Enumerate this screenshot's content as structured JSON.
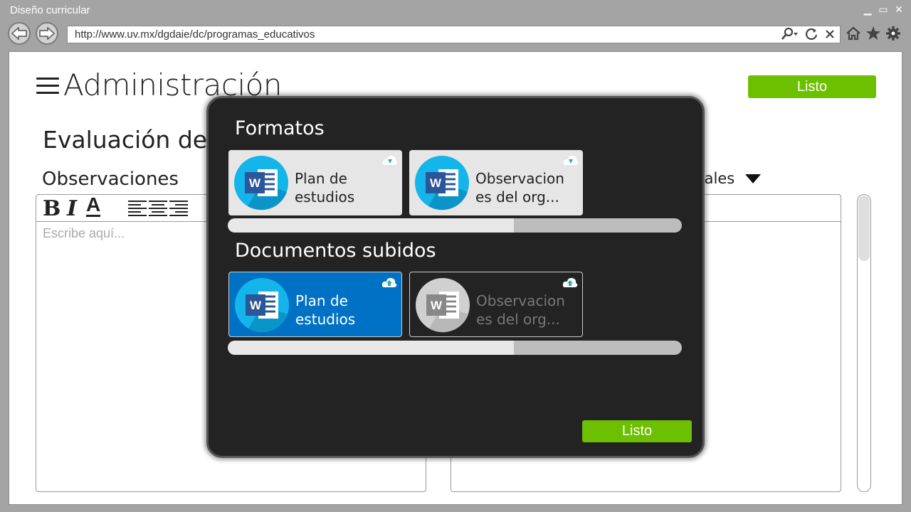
{
  "window": {
    "title": "Diseño curricular",
    "minimize_icon": "minimize-icon",
    "maximize_icon": "maximize-icon",
    "close_icon": "close-icon"
  },
  "toolbar": {
    "back_icon": "back-arrow-icon",
    "forward_icon": "forward-arrow-icon",
    "url": "http://www.uv.mx/dgdaie/dc/programas_educativos",
    "search_icon": "search-icon",
    "refresh_icon": "refresh-icon",
    "stop_icon": "stop-icon",
    "home_icon": "home-icon",
    "favorites_icon": "star-icon",
    "settings_icon": "gear-icon"
  },
  "page": {
    "title": "Administración",
    "done_button": "Listo",
    "section_title": "Evaluación del",
    "observations_title": "Observaciones",
    "editor_placeholder": "Escribe aquí...",
    "editor_tools": {
      "bold": "B",
      "italic": "I",
      "font_color": "A"
    },
    "dropdown_partial_label": "rales"
  },
  "modal": {
    "formats_title": "Formatos",
    "formats": [
      {
        "label_line1": "Plan de",
        "label_line2": "estudios",
        "icon": "word-icon",
        "badge": "download-icon"
      },
      {
        "label_line1": "Observacion",
        "label_line2": "es del org...",
        "icon": "word-icon",
        "badge": "download-icon"
      }
    ],
    "formats_progress": 0.63,
    "uploaded_title": "Documentos subidos",
    "uploaded": [
      {
        "label_line1": "Plan de",
        "label_line2": "estudios",
        "icon": "word-icon",
        "badge": "upload-cloud-icon",
        "state": "selected"
      },
      {
        "label_line1": "Observacion",
        "label_line2": "es del org...",
        "icon": "word-icon",
        "badge": "upload-cloud-icon",
        "state": "disabled"
      }
    ],
    "uploaded_progress": 0.63,
    "done_button": "Listo"
  },
  "colors": {
    "accent_green": "#6cc000",
    "word_blue": "#0072c6",
    "modal_bg": "#232323"
  }
}
